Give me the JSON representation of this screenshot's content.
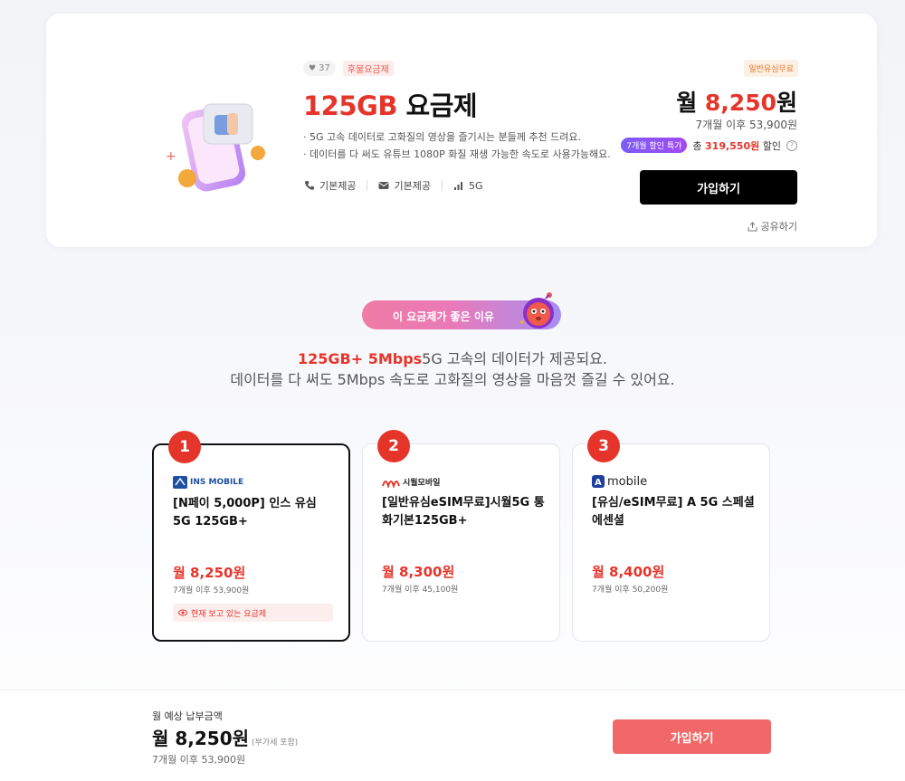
{
  "plan": {
    "likes": "37",
    "postpaid_tag": "후불요금제",
    "title_highlight": "125GB",
    "title_rest": " 요금제",
    "desc": [
      "· 5G 고속 데이터로 고화질의 영상을 즐기시는 분들께 추천 드려요.",
      "· 데이터를 다 써도 유튜브 1080P 화질 재생 가능한 속도로 사용가능해요."
    ],
    "features": [
      {
        "icon": "phone-icon",
        "label": "기본제공"
      },
      {
        "icon": "message-icon",
        "label": "기본제공"
      },
      {
        "icon": "signal-icon",
        "label": "5G"
      }
    ],
    "usim_tag": "일반유심무료",
    "price_prefix": "월 ",
    "price": "8,250",
    "price_suffix": "원",
    "after_price": "7개월 이후 53,900원",
    "discount_badge": "7개월 할인 특가",
    "discount_prefix": "총 ",
    "discount_amount": "319,550원",
    "discount_suffix": " 할인",
    "join_label": "가입하기",
    "share_label": "공유하기"
  },
  "reason": {
    "pill_label": "이 요금제가 좋은 이유",
    "line1_highlight": "125GB+ 5Mbps",
    "line1_rest": "5G 고속의 데이터가 제공되요.",
    "line2": "데이터를 다 써도 5Mbps 속도로 고화질의 영상을 마음껏 즐길 수 있어요."
  },
  "ranking": [
    {
      "rank": "1",
      "carrier": "INS MOBILE",
      "name": "[N페이 5,000P] 인스 유심 5G 125GB+",
      "price": "월 8,250원",
      "after": "7개월 이후 53,900원",
      "viewing": "현재 보고 있는 요금제"
    },
    {
      "rank": "2",
      "carrier": "시월모바일",
      "name": "[일반유심eSIM무료]시월5G 통화기본125GB+",
      "price": "월 8,300원",
      "after": "7개월 이후 45,100원"
    },
    {
      "rank": "3",
      "carrier": "mobile",
      "name": "[유심/eSIM무료] A 5G 스페셜 에센셜",
      "price": "월 8,400원",
      "after": "7개월 이후 50,200원"
    }
  ],
  "footer": {
    "label": "월 예상 납부금액",
    "price": "월 8,250원",
    "vat": "(부가세 포함)",
    "after": "7개월 이후 53,900원",
    "join_label": "가입하기"
  },
  "colors": {
    "accent": "#e5352b",
    "primary_button": "#000000",
    "footer_button": "#f26868"
  }
}
